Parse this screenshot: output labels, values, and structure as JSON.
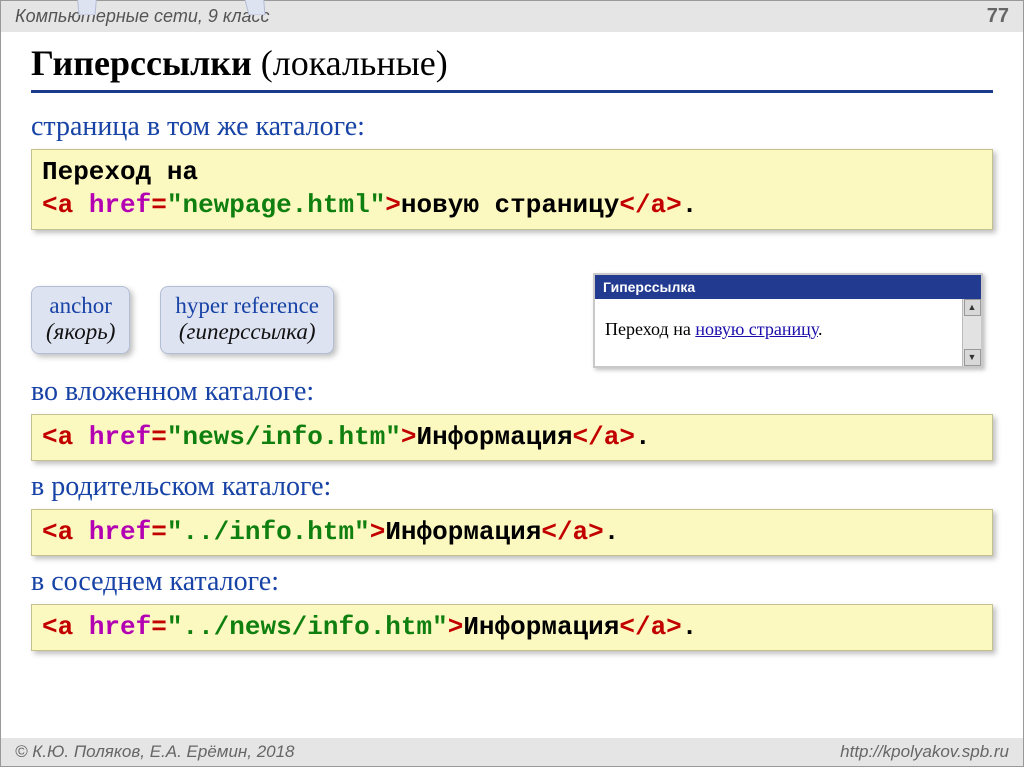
{
  "header": {
    "subject": "Компьютерные сети, 9 класс",
    "page": "77"
  },
  "title": {
    "bold": "Гиперссылки",
    "rest": " (локальные)"
  },
  "section1": {
    "heading": "страница в том же каталоге:",
    "code": {
      "l1": "Переход на ",
      "tag_open": "<a",
      "sp1": " ",
      "attr": "href",
      "eq": "=",
      "val": "\"newpage.html\"",
      "gt": ">",
      "text": "новую страницу",
      "tag_close": "</a>",
      "dot": "."
    }
  },
  "callouts": {
    "c1": {
      "l1": "anchor",
      "l2": "(якорь)"
    },
    "c2": {
      "l1": "hyper reference",
      "l2": "(гиперссылка)"
    }
  },
  "browser": {
    "title": "Гиперссылка",
    "text_before": "Переход на ",
    "link": "новую страницу",
    "text_after": "."
  },
  "section2": {
    "heading": "во вложенном каталоге:",
    "code": {
      "tag_open": "<a",
      "sp1": " ",
      "attr": "href",
      "eq": "=",
      "val": "\"news/info.htm\"",
      "gt": ">",
      "text": "Информация",
      "tag_close": "</a>",
      "dot": "."
    }
  },
  "section3": {
    "heading": "в родительском каталоге:",
    "code": {
      "tag_open": "<a",
      "sp1": " ",
      "attr": "href",
      "eq": "=",
      "val": "\"../info.htm\"",
      "gt": ">",
      "text": "Информация",
      "tag_close": "</a>",
      "dot": "."
    }
  },
  "section4": {
    "heading": "в соседнем каталоге:",
    "code": {
      "tag_open": "<a",
      "sp1": " ",
      "attr": "href",
      "eq": "=",
      "val": "\"../news/info.htm\"",
      "gt": ">",
      "text": "Информация",
      "tag_close": "</a>",
      "dot": "."
    }
  },
  "footer": {
    "copyright": "© К.Ю. Поляков, Е.А. Ерёмин, 2018",
    "url": "http://kpolyakov.spb.ru"
  }
}
